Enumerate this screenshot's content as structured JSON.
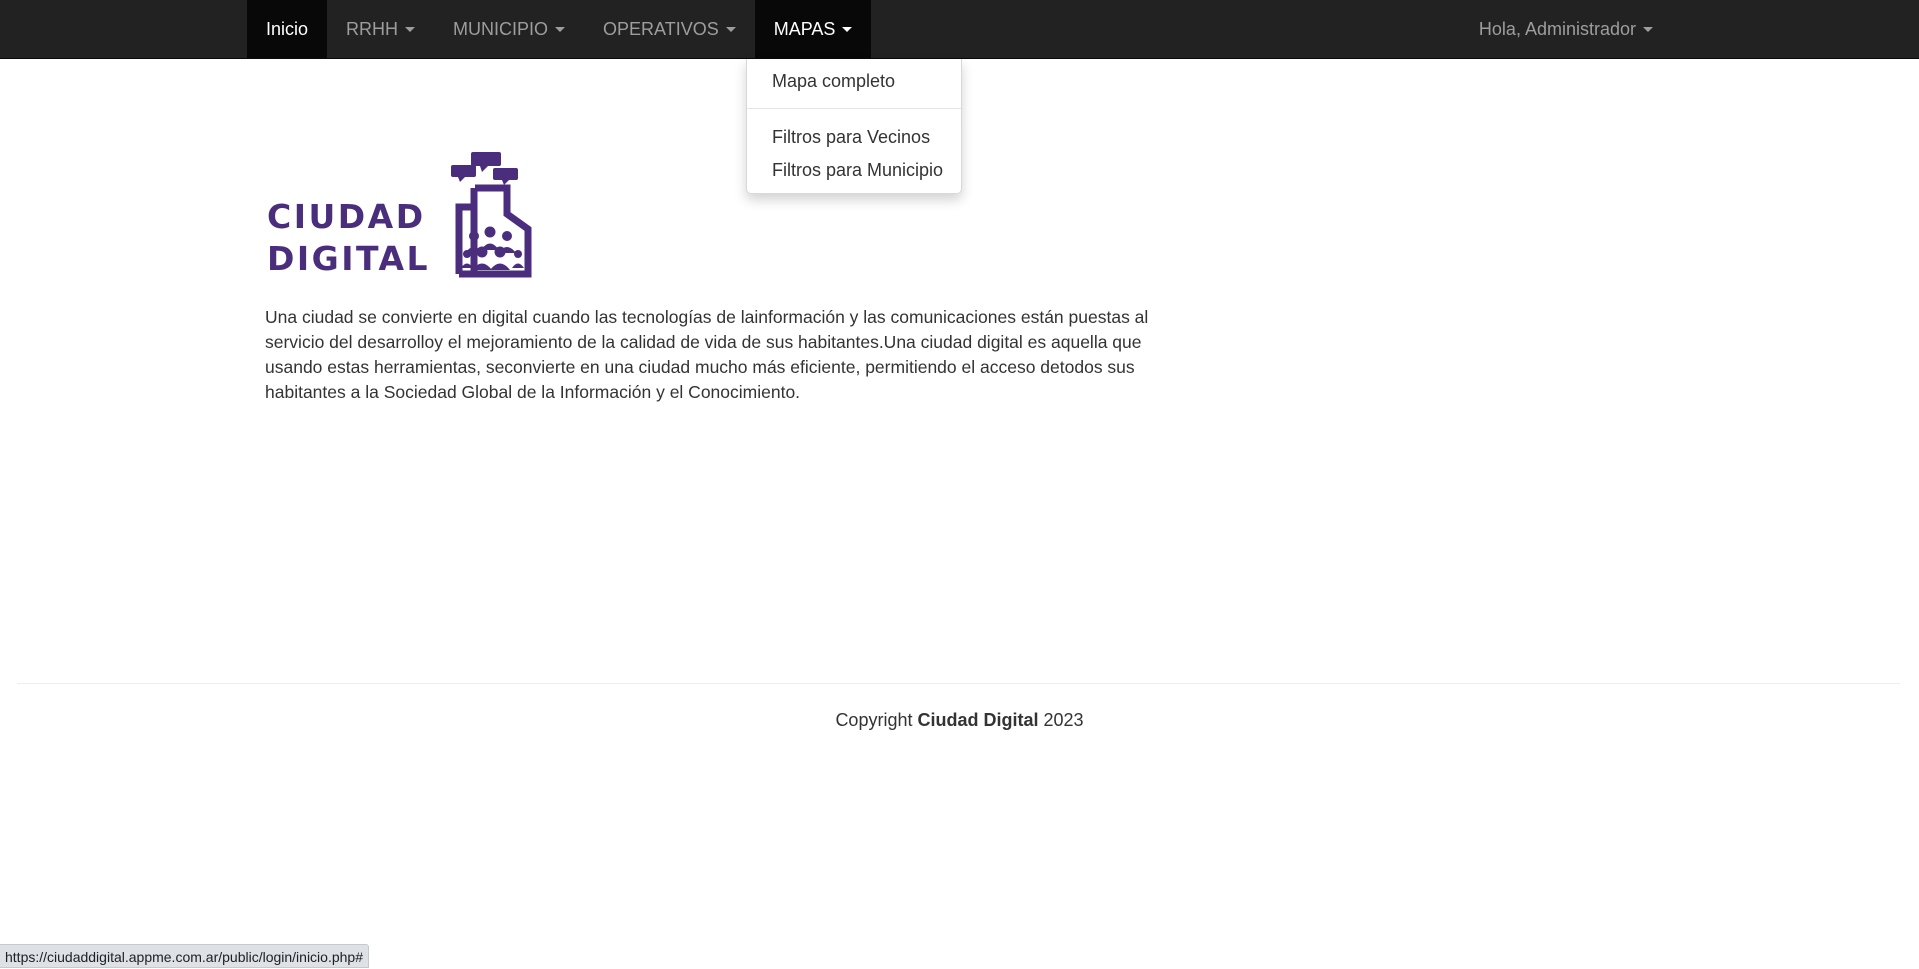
{
  "navbar": {
    "items": [
      {
        "label": "Inicio",
        "active": true,
        "dropdown": false
      },
      {
        "label": "RRHH",
        "active": false,
        "dropdown": true
      },
      {
        "label": "MUNICIPIO",
        "active": false,
        "dropdown": true
      },
      {
        "label": "OPERATIVOS",
        "active": false,
        "dropdown": true
      },
      {
        "label": "MAPAS",
        "active": true,
        "dropdown": true
      }
    ],
    "user_greeting": "Hola, Administrador"
  },
  "mapas_menu": {
    "items": [
      "Mapa completo",
      "Filtros para Vecinos",
      "Filtros para Municipio"
    ]
  },
  "logo": {
    "line1": "CIUDAD",
    "line2": "DIGITAL",
    "color": "#4a2e7d"
  },
  "main": {
    "intro": "Una ciudad se convierte en digital cuando las tecnologías de lainformación y las comunicaciones están puestas al servicio del desarrolloy el mejoramiento de la calidad de vida de sus habitantes.Una ciudad digital es aquella que usando estas herramientas, seconvierte en una ciudad mucho más eficiente, permitiendo el acceso detodos sus habitantes a la Sociedad Global de la Información y el Conocimiento."
  },
  "footer": {
    "prefix": "Copyright",
    "brand": "Ciudad Digital",
    "year": "2023"
  },
  "statusbar": {
    "url": "https://ciudaddigital.appme.com.ar/public/login/inicio.php#"
  },
  "colors": {
    "navbar_bg": "#222222",
    "navbar_active": "#080808",
    "brand_purple": "#4a2e7d"
  }
}
